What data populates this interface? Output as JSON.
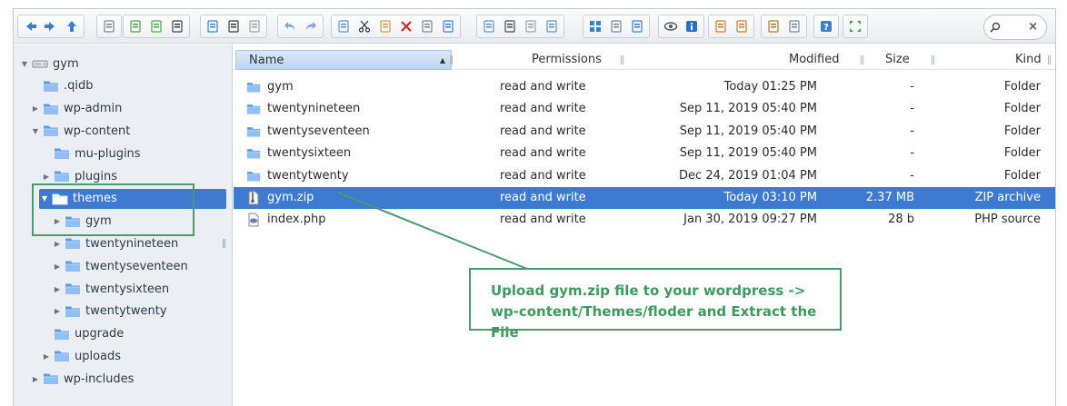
{
  "toolbar": {
    "groups": [
      [
        "back-icon",
        "forward-icon",
        "up-icon"
      ],
      [
        "computer-icon"
      ],
      [
        "new-file-icon",
        "new-file-add-icon",
        "save-icon"
      ],
      [
        "panel-icon",
        "save-as-icon",
        "select-icon"
      ],
      [
        "undo-icon",
        "redo-icon"
      ],
      [
        "copy-icon",
        "cut-icon",
        "paste-icon",
        "delete-icon",
        "rename-icon",
        "edit-icon"
      ],
      [
        "duplicate-icon",
        "select-all-icon",
        "clip-icon",
        "archive-icon"
      ],
      [
        "grid-view-icon",
        "small-icons-icon",
        "thumbs-icon"
      ],
      [
        "preview-icon",
        "info-icon"
      ],
      [
        "extract-icon",
        "compress-icon"
      ],
      [
        "icons-view-icon",
        "settings-icon"
      ],
      [
        "help-icon"
      ],
      [
        "fullscreen-icon"
      ]
    ],
    "search_placeholder": "",
    "search_clear": "×"
  },
  "sidebar": {
    "items": [
      {
        "label": "gym",
        "indent": 0,
        "arrow": "▼",
        "icon": "drive-icon"
      },
      {
        "label": ".qidb",
        "indent": 1,
        "arrow": "",
        "icon": "folder-icon"
      },
      {
        "label": "wp-admin",
        "indent": 1,
        "arrow": "▶",
        "icon": "folder-icon"
      },
      {
        "label": "wp-content",
        "indent": 1,
        "arrow": "▼",
        "icon": "folder-icon"
      },
      {
        "label": "mu-plugins",
        "indent": 2,
        "arrow": "",
        "icon": "folder-icon"
      },
      {
        "label": "plugins",
        "indent": 2,
        "arrow": "▶",
        "icon": "folder-icon"
      },
      {
        "label": "themes",
        "indent": 2,
        "arrow": "▼",
        "icon": "folder-open-icon",
        "selected": true
      },
      {
        "label": "gym",
        "indent": 3,
        "arrow": "▶",
        "icon": "folder-icon"
      },
      {
        "label": "twentynineteen",
        "indent": 3,
        "arrow": "▶",
        "icon": "folder-icon"
      },
      {
        "label": "twentyseventeen",
        "indent": 3,
        "arrow": "▶",
        "icon": "folder-icon"
      },
      {
        "label": "twentysixteen",
        "indent": 3,
        "arrow": "▶",
        "icon": "folder-icon"
      },
      {
        "label": "twentytwenty",
        "indent": 3,
        "arrow": "▶",
        "icon": "folder-icon"
      },
      {
        "label": "upgrade",
        "indent": 2,
        "arrow": "",
        "icon": "folder-icon"
      },
      {
        "label": "uploads",
        "indent": 2,
        "arrow": "▶",
        "icon": "folder-icon"
      },
      {
        "label": "wp-includes",
        "indent": 1,
        "arrow": "▶",
        "icon": "folder-icon"
      }
    ]
  },
  "files": {
    "columns": {
      "name": "Name",
      "sort": "▲",
      "permissions": "Permissions",
      "modified": "Modified",
      "size": "Size",
      "kind": "Kind"
    },
    "rows": [
      {
        "icon": "folder-icon",
        "name": "gym",
        "permissions": "read and write",
        "modified": "Today 01:25 PM",
        "size": "-",
        "kind": "Folder"
      },
      {
        "icon": "folder-icon",
        "name": "twentynineteen",
        "permissions": "read and write",
        "modified": "Sep 11, 2019 05:40 PM",
        "size": "-",
        "kind": "Folder"
      },
      {
        "icon": "folder-icon",
        "name": "twentyseventeen",
        "permissions": "read and write",
        "modified": "Sep 11, 2019 05:40 PM",
        "size": "-",
        "kind": "Folder"
      },
      {
        "icon": "folder-icon",
        "name": "twentysixteen",
        "permissions": "read and write",
        "modified": "Sep 11, 2019 05:40 PM",
        "size": "-",
        "kind": "Folder"
      },
      {
        "icon": "folder-icon",
        "name": "twentytwenty",
        "permissions": "read and write",
        "modified": "Dec 24, 2019 01:04 PM",
        "size": "-",
        "kind": "Folder"
      },
      {
        "icon": "zip-file-icon",
        "name": "gym.zip",
        "permissions": "read and write",
        "modified": "Today 03:10 PM",
        "size": "2.37 MB",
        "kind": "ZIP archive",
        "selected": true
      },
      {
        "icon": "php-file-icon",
        "name": "index.php",
        "permissions": "read and write",
        "modified": "Jan 30, 2019 09:27 PM",
        "size": "28 b",
        "kind": "PHP source"
      }
    ]
  },
  "annotation": {
    "line1": "Upload gym.zip file to your wordpress ->",
    "line2": "wp-content/Themes/floder and Extract the File"
  },
  "colors": {
    "selection": "#3f7ad1",
    "folder": "#5b9be6",
    "annotation_green": "#3f9a5f",
    "sidebar_bg": "#ebeff4"
  }
}
